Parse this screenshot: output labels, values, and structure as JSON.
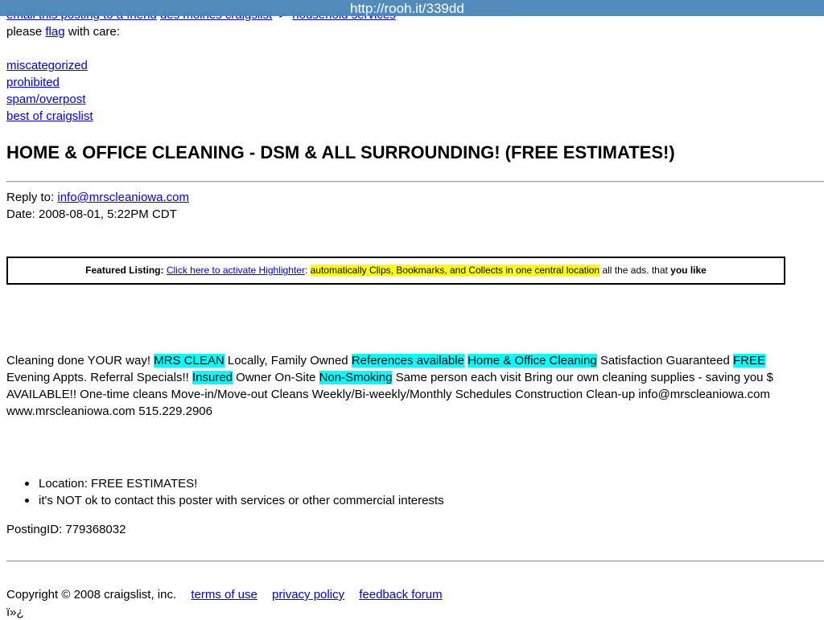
{
  "overlay": {
    "url": "http://rooh.it/339dd"
  },
  "nav": {
    "email_friend": "email this posting to a friend",
    "site": "des moines craigslist",
    "separator": ">",
    "category": "household services"
  },
  "flag": {
    "prefix": "please ",
    "link": "flag",
    "suffix": " with care:",
    "options": [
      "miscategorized",
      "prohibited",
      "spam/overpost",
      "best of craigslist"
    ]
  },
  "posting": {
    "title": "HOME & OFFICE CLEANING - DSM & ALL SURROUNDING! (FREE ESTIMATES!)",
    "reply_label": "Reply to: ",
    "reply_email": "info@mrscleaniowa.com",
    "date": "Date: 2008-08-01,  5:22PM CDT"
  },
  "featured": {
    "label": "Featured Listing:",
    "link": "Click here to activate Highlighter",
    "colon": ":",
    "highlight": "automatically Clips, Bookmarks, and Collects in one central location",
    "tail": " all the ads. that ",
    "bold_tail": "you like"
  },
  "body": {
    "line1": [
      {
        "t": "Cleaning done YOUR way! ",
        "hl": false
      },
      {
        "t": "MRS CLEAN",
        "hl": true
      },
      {
        "t": " Locally, Family Owned ",
        "hl": false
      },
      {
        "t": "References available",
        "hl": true
      },
      {
        "t": " ",
        "hl": false
      },
      {
        "t": "Home & Office Cleaning",
        "hl": true
      },
      {
        "t": " Satisfaction Guaranteed ",
        "hl": false
      },
      {
        "t": "FREE",
        "hl": true
      }
    ],
    "line2": [
      {
        "t": "Evening Appts. Referral Specials!! ",
        "hl": false
      },
      {
        "t": "Insured",
        "hl": true
      },
      {
        "t": " Owner On-Site ",
        "hl": false
      },
      {
        "t": "Non-Smoking",
        "hl": true
      },
      {
        "t": " Same person each visit Bring our own cleaning supplies - saving you $",
        "hl": false
      }
    ],
    "line3": "AVAILABLE!! One-time cleans Move-in/Move-out Cleans Weekly/Bi-weekly/Monthly Schedules Construction Clean-up info@mrscleaniowa.com",
    "line4": "www.mrscleaniowa.com 515.229.2906"
  },
  "details": {
    "location": "Location: FREE ESTIMATES!",
    "notice": "it's NOT ok to contact this poster with services or other commercial interests",
    "posting_id": "PostingID: 779368032"
  },
  "footer": {
    "copyright": "Copyright © 2008 craigslist, inc.",
    "links": [
      "terms of use",
      "privacy policy",
      "feedback forum"
    ],
    "trailing": "ï»¿"
  },
  "colors": {
    "link": "#0000ee",
    "highlight_cyan": "#00ffff",
    "highlight_yellow": "#ffff00",
    "overlay_bar": "#4a86b8"
  }
}
